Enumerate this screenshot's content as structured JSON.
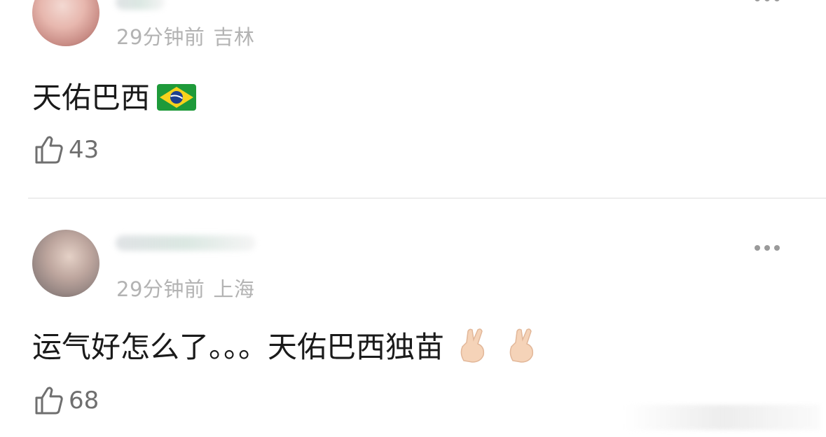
{
  "comments": [
    {
      "time": "29分钟前",
      "location": "吉林",
      "text": "天佑巴西",
      "emoji": "brazil-flag",
      "likes": "43"
    },
    {
      "time": "29分钟前",
      "location": "上海",
      "text": "运气好怎么了。。。天佑巴西独苗",
      "emoji": "crossed-fingers",
      "likes": "68"
    }
  ],
  "colors": {
    "meta_text": "#b3b3b3",
    "body_text": "#1a1a1a",
    "like_text": "#6f6f6f",
    "divider": "#ededed"
  }
}
